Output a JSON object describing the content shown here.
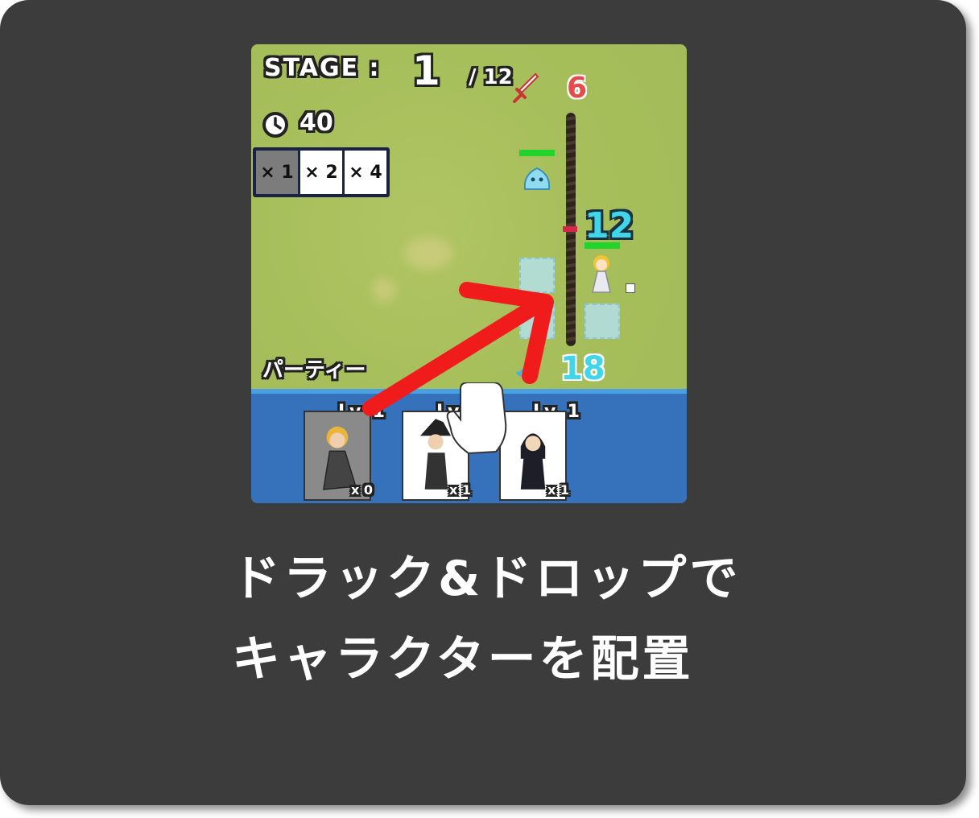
{
  "game": {
    "stage_label": "STAGE :",
    "stage_number": "1",
    "stage_total": "/ 12",
    "timer": "40",
    "speed_options": [
      "× 1",
      "× 2",
      "× 4"
    ],
    "speed_selected": 0,
    "enemy_power": "6",
    "ally_power": "12",
    "party_power": "18",
    "party_label": "パーティー",
    "party_cards": [
      {
        "level": "Lv. 1",
        "count": "x 0"
      },
      {
        "level": "Lv. 1",
        "count": "x 1"
      },
      {
        "level": "Lv. 1",
        "count": "x 1"
      }
    ]
  },
  "caption": {
    "line1": "ドラック&ドロップで",
    "line2": "キャラクターを配置"
  },
  "colors": {
    "background": "#3c3c3c",
    "field": "#a6bf5b",
    "water": "#3672bc",
    "arrow": "#f01c1c",
    "enemy_power": "#e74a4a",
    "ally_power": "#3fd6ea"
  },
  "icons": [
    "clock-icon",
    "sword-icon",
    "slime-enemy",
    "hand-cursor-icon",
    "drag-arrow"
  ]
}
